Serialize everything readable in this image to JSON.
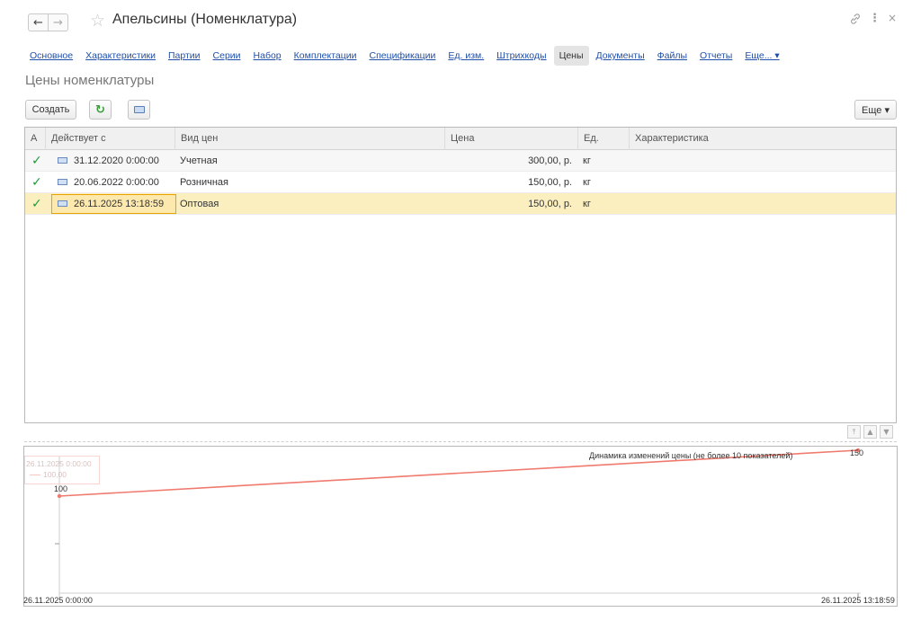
{
  "window": {
    "title": "Апельсины (Номенклатура)",
    "icons": [
      "back-arrow-icon",
      "forward-arrow-icon",
      "star-icon",
      "link-icon",
      "more-vertical-icon",
      "close-icon"
    ]
  },
  "tabs": [
    {
      "label": "Основное",
      "active": false
    },
    {
      "label": "Характеристики",
      "active": false
    },
    {
      "label": "Партии",
      "active": false
    },
    {
      "label": "Серии",
      "active": false
    },
    {
      "label": "Набор",
      "active": false
    },
    {
      "label": "Комплектации",
      "active": false
    },
    {
      "label": "Спецификации",
      "active": false
    },
    {
      "label": "Ед. изм.",
      "active": false
    },
    {
      "label": "Штрихкоды",
      "active": false
    },
    {
      "label": "Цены",
      "active": true
    },
    {
      "label": "Документы",
      "active": false
    },
    {
      "label": "Файлы",
      "active": false
    },
    {
      "label": "Отчеты",
      "active": false
    },
    {
      "label": "Еще... ▾",
      "active": false
    }
  ],
  "section_title": "Цены номенклатуры",
  "toolbar": {
    "create_label": "Создать",
    "more_label": "Еще ▾"
  },
  "table": {
    "columns": [
      "А",
      "Действует с",
      "Вид цен",
      "Цена",
      "Ед.",
      "Характеристика"
    ],
    "rows": [
      {
        "active": "✓",
        "date": "31.12.2020 0:00:00",
        "price_type": "Учетная",
        "price": "300,00, р.",
        "unit": "кг",
        "characteristic": ""
      },
      {
        "active": "✓",
        "date": "20.06.2022 0:00:00",
        "price_type": "Розничная",
        "price": "150,00, р.",
        "unit": "кг",
        "characteristic": ""
      },
      {
        "active": "✓",
        "date": "26.11.2025 13:18:59",
        "price_type": "Оптовая",
        "price": "150,00, р.",
        "unit": "кг",
        "characteristic": ""
      }
    ],
    "selected_row": 2
  },
  "chart_data": {
    "type": "line",
    "title": "Динамика изменений цены (не более 10 показателей)",
    "x": [
      "26.11.2025 0:00:00",
      "26.11.2025 13:18:59"
    ],
    "series": [
      {
        "values": [
          100,
          150
        ]
      }
    ],
    "data_labels": [
      "100",
      "150"
    ],
    "tick_labels": [
      "26.11.2025 0:00:00",
      "26.11.2025 13:18:59"
    ],
    "ghost_tooltip": {
      "date": "26.11.2025 0:00:00",
      "value": "100,00"
    },
    "line_color": "#f07a6e",
    "grid": false
  }
}
